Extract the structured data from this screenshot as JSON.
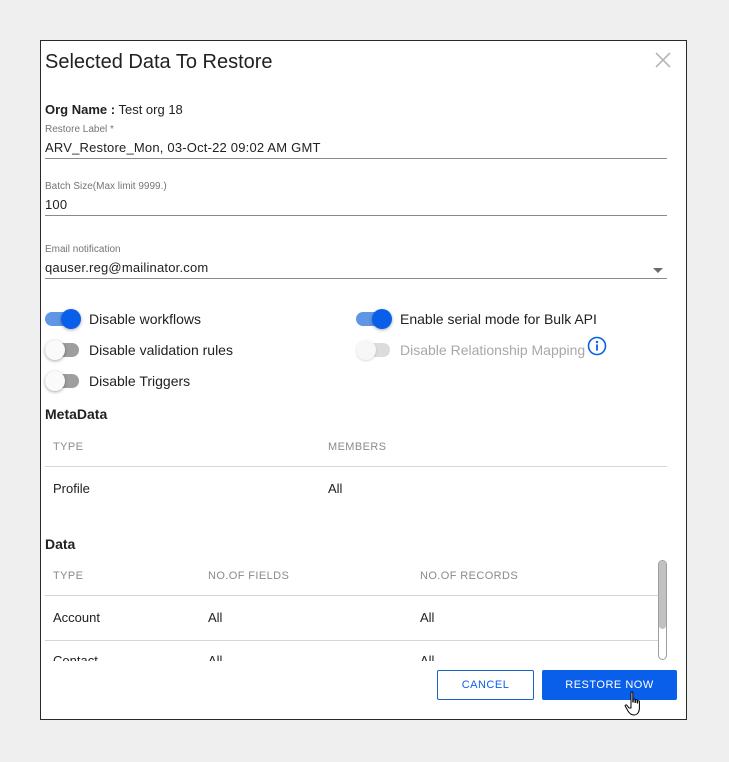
{
  "dialog": {
    "title": "Selected Data To Restore",
    "org_label": "Org Name :",
    "org_value": "Test org 18",
    "restore_label": {
      "label": "Restore Label *",
      "value": "ARV_Restore_Mon, 03-Oct-22 09:02 AM GMT"
    },
    "batch_size": {
      "label": "Batch Size(Max limit 9999.)",
      "value": "100"
    },
    "email": {
      "label": "Email notification",
      "value": "qauser.reg@mailinator.com"
    },
    "toggles": {
      "disable_workflows": {
        "label": "Disable workflows",
        "checked": true
      },
      "disable_validation": {
        "label": "Disable validation rules",
        "checked": false
      },
      "disable_triggers": {
        "label": "Disable Triggers",
        "checked": false
      },
      "serial_mode": {
        "label": "Enable serial mode for Bulk API",
        "checked": true
      },
      "relationship_mapping": {
        "label": "Disable Relationship Mapping",
        "checked": false,
        "disabled": true
      }
    },
    "metadata": {
      "title": "MetaData",
      "headers": {
        "type": "TYPE",
        "members": "MEMBERS"
      },
      "rows": [
        {
          "type": "Profile",
          "members": "All"
        }
      ]
    },
    "data": {
      "title": "Data",
      "headers": {
        "type": "TYPE",
        "fields": "NO.OF FIELDS",
        "records": "NO.OF RECORDS"
      },
      "rows": [
        {
          "type": "Account",
          "fields": "All",
          "records": "All"
        },
        {
          "type": "Contact",
          "fields": "All",
          "records": "All"
        }
      ]
    },
    "buttons": {
      "cancel": "CANCEL",
      "restore": "RESTORE NOW"
    },
    "icons": {
      "close": "close-icon",
      "info": "info-icon",
      "dropdown": "chevron-down-icon",
      "cursor": "hand-pointer-icon"
    },
    "colors": {
      "primary": "#0a5fea",
      "toggle_track_on": "#5f97e6",
      "border": "#2a2a2a"
    }
  }
}
